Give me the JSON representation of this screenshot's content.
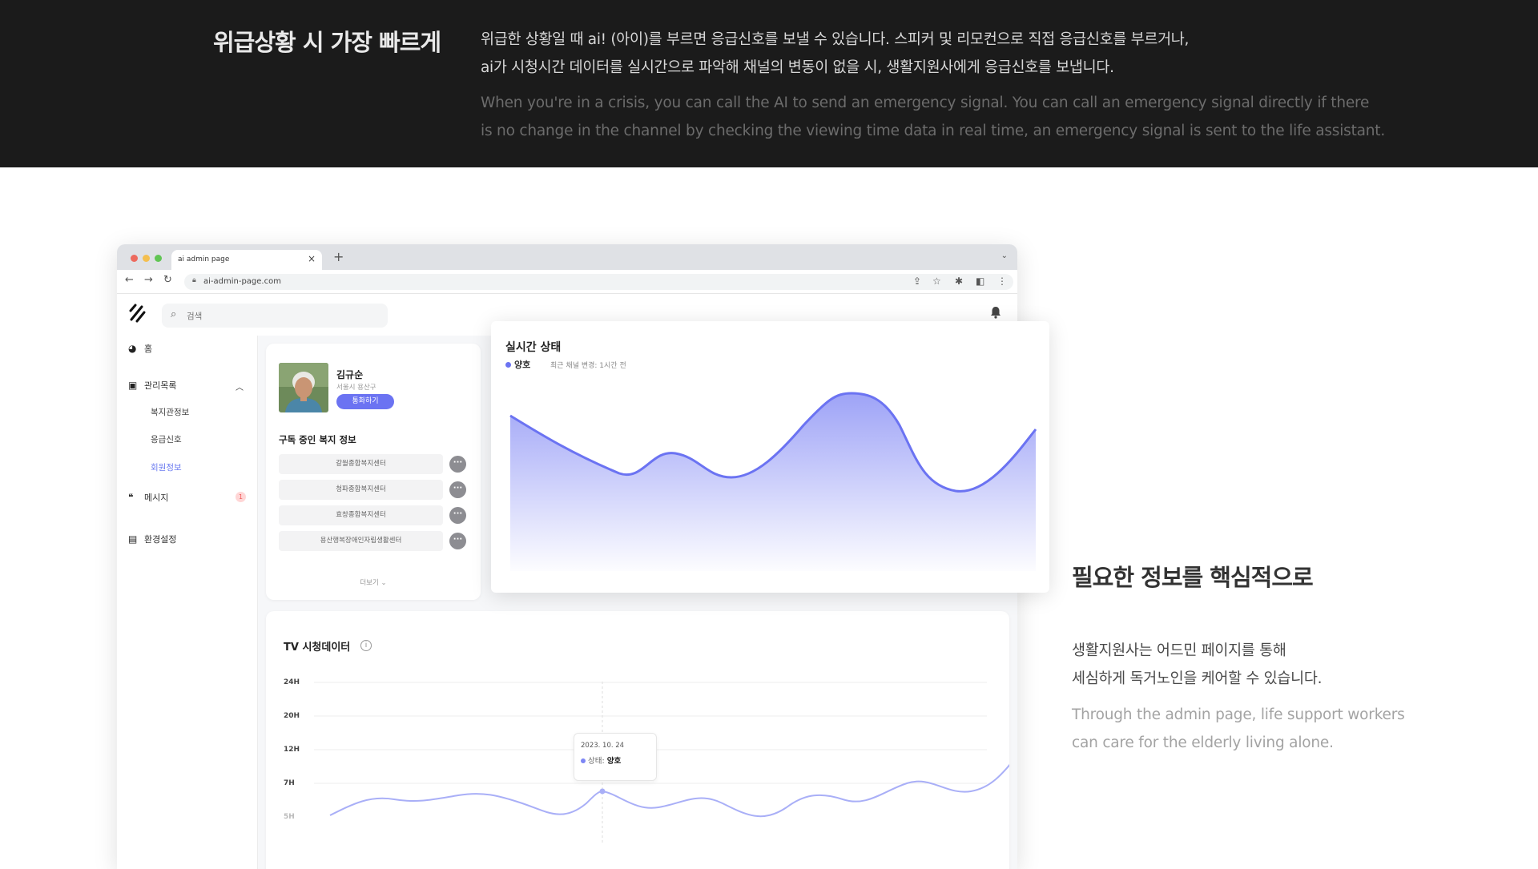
{
  "emergency": {
    "title": "위급상황 시 가장 빠르게",
    "ko_line1": "위급한 상황일 때 ai! (아이)를 부르면 응급신호를 보낼 수 있습니다. 스피커 및 리모컨으로 직접 응급신호를 부르거나,",
    "ko_line2": "ai가 시청시간 데이터를 실시간으로 파악해 채널의 변동이 없을 시, 생활지원사에게 응급신호를 보냅니다.",
    "en_line1": "When you're in a crisis, you can call the AI to send an emergency signal. You can call an emergency signal directly if there",
    "en_line2": "is no change in the channel by checking the viewing time data in real time, an emergency signal is sent to the life assistant."
  },
  "browser": {
    "tab_title": "ai admin page",
    "tab_close": "×",
    "new_tab": "+",
    "url": "ai-admin-page.com"
  },
  "app": {
    "search_placeholder": "검색",
    "sidebar": {
      "home": "홈",
      "manage": "관리목록",
      "sub1": "복지관정보",
      "sub2": "응급신호",
      "sub3": "회원정보",
      "messages": "메시지",
      "messages_badge": "1",
      "settings": "환경설정"
    },
    "profile": {
      "name": "김규순",
      "location": "서울시 용산구",
      "call_button": "통화하기",
      "subscribed_title": "구독 중인 복지 정보",
      "welfare": [
        "갈월종합복지센터",
        "청파종합복지센터",
        "효창종합복지센터",
        "용산행복장애인자립생활센터"
      ],
      "more": "더보기"
    },
    "realtime": {
      "title": "실시간 상태",
      "status": "양호",
      "last_change": "최근 채널 변경: 1시간 전",
      "accent": "#6b73f2"
    },
    "tv": {
      "title": "TV 시청데이터",
      "info_icon": "i",
      "y_labels": [
        "24H",
        "20H",
        "12H",
        "7H",
        "5H"
      ],
      "tooltip_date": "2023. 10. 24",
      "tooltip_label": "상태:",
      "tooltip_value": "양호"
    }
  },
  "care": {
    "title": "필요한 정보를 핵심적으로",
    "ko_line1": "생활지원사는 어드민 페이지를 통해",
    "ko_line2": "세심하게 독거노인을 케어할 수 있습니다.",
    "en_line1": "Through the admin page, life support workers",
    "en_line2": "can care for the elderly living alone."
  }
}
